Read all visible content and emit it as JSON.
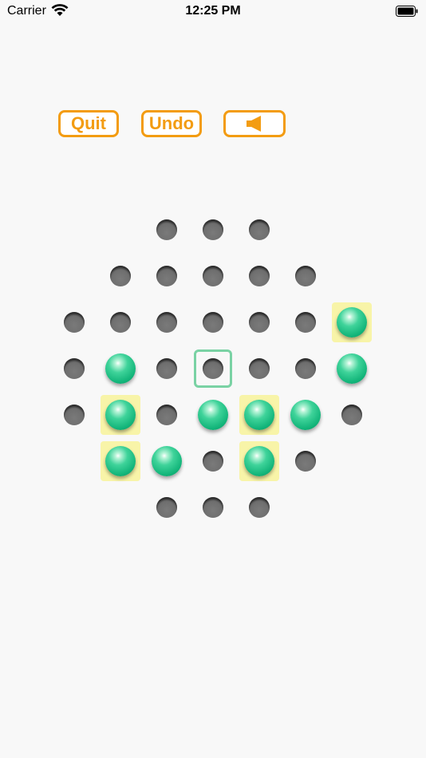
{
  "status_bar": {
    "carrier": "Carrier",
    "time": "12:25 PM"
  },
  "toolbar": {
    "quit_label": "Quit",
    "undo_label": "Undo",
    "sound_icon": "speaker-icon"
  },
  "colors": {
    "accent": "#f39c12",
    "peg": "#13b57a",
    "highlight": "#f8f4a8",
    "selection": "#7ad2a4",
    "hole": "#6e6e6e"
  },
  "board": {
    "columns": 7,
    "rows": 7,
    "cells": [
      [
        null,
        null,
        "hole",
        "hole",
        "hole",
        null,
        null
      ],
      [
        null,
        "hole",
        "hole",
        "hole",
        "hole",
        "hole",
        null
      ],
      [
        "hole",
        "hole",
        "hole",
        "hole",
        "hole",
        "hole",
        "peg-highlight"
      ],
      [
        "hole",
        "peg",
        "hole",
        "hole-selected",
        "hole",
        "hole",
        "peg"
      ],
      [
        "hole",
        "peg-highlight",
        "hole",
        "peg",
        "peg-highlight",
        "peg",
        "hole"
      ],
      [
        null,
        "peg-highlight",
        "peg",
        "hole",
        "peg-highlight",
        "hole",
        null
      ],
      [
        null,
        null,
        "hole",
        "hole",
        "hole",
        null,
        null
      ]
    ]
  }
}
